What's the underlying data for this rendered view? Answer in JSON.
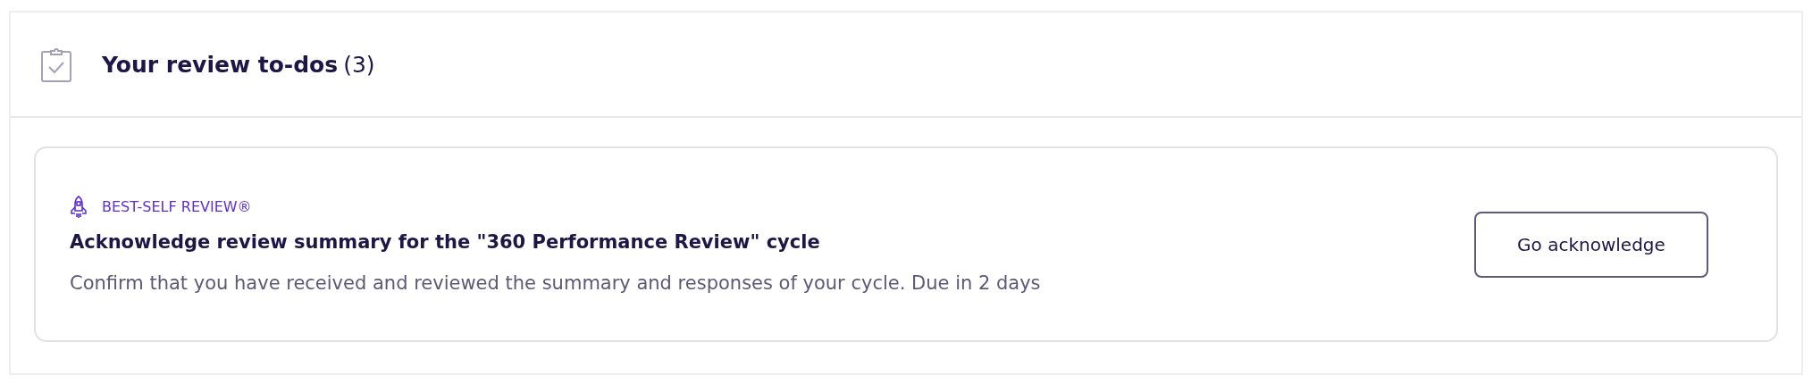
{
  "panel": {
    "title": "Your review to-dos",
    "count": "(3)"
  },
  "todos": [
    {
      "category": "BEST-SELF REVIEW®",
      "title": "Acknowledge review summary for the \"360 Performance Review\" cycle",
      "description": "Confirm that you have received and reviewed the summary and responses of your cycle. Due in 2 days",
      "action": "Go acknowledge"
    }
  ]
}
